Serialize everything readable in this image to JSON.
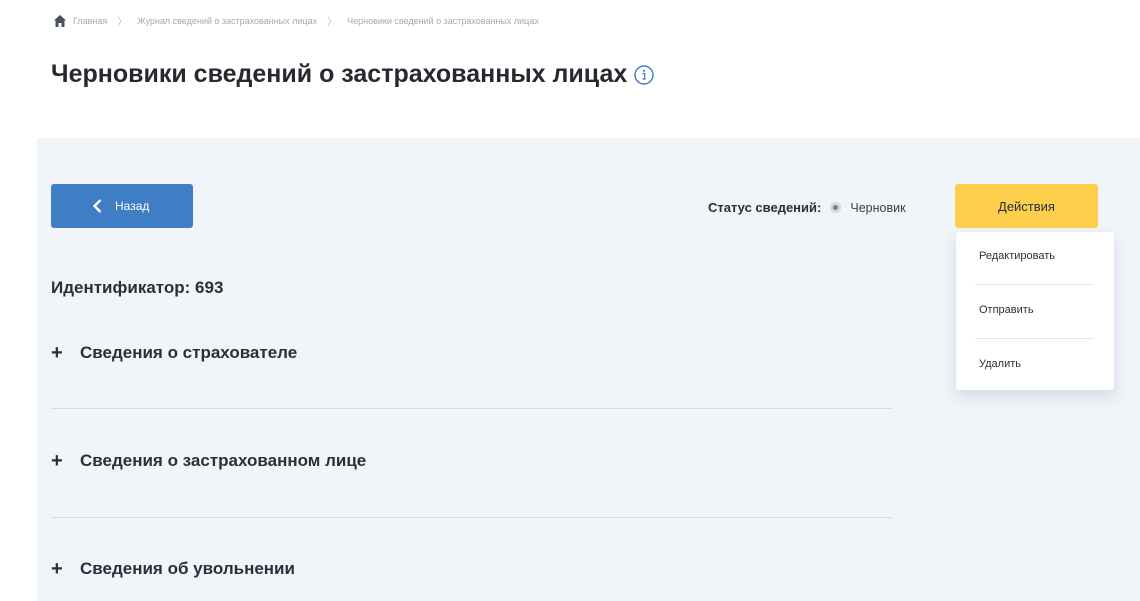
{
  "breadcrumb": {
    "items": [
      "Главная",
      "Журнал сведений о застрахованных лицах",
      "Черновики сведений о застрахованных лицах"
    ]
  },
  "page": {
    "title": "Черновики сведений о застрахованных лицах"
  },
  "toolbar": {
    "back_label": "Назад",
    "status_label": "Статус сведений:",
    "status_value": "Черновик",
    "actions_label": "Действия"
  },
  "actions_menu": {
    "items": [
      "Редактировать",
      "Отправить",
      "Удалить"
    ]
  },
  "record": {
    "identifier": "Идентификатор: 693"
  },
  "sections": [
    {
      "label": "Сведения о страхователе"
    },
    {
      "label": "Сведения о застрахованном лице"
    },
    {
      "label": "Сведения об увольнении"
    }
  ],
  "colors": {
    "primary_button": "#3f7dc5",
    "actions_button": "#fccf4d",
    "panel_bg": "#f1f4f9",
    "info_icon": "#3f7dc5"
  },
  "icons": {
    "home": "home-icon",
    "separator": "chevron-right-icon",
    "info": "info-icon",
    "back": "chevron-left-icon",
    "status": "status-dot-icon",
    "expand": "plus-icon"
  }
}
